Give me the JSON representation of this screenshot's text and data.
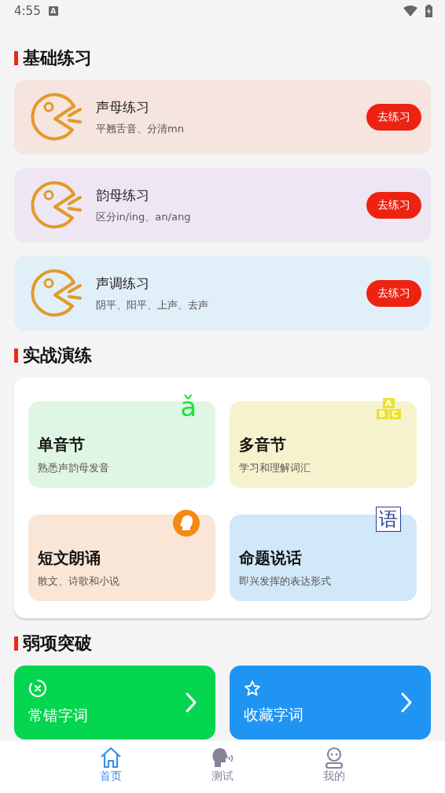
{
  "status_bar": {
    "time": "4:55",
    "notification": "A"
  },
  "sections": [
    {
      "title": "基础练习"
    },
    {
      "title": "实战演练"
    },
    {
      "title": "弱项突破"
    }
  ],
  "basic": [
    {
      "title": "声母练习",
      "subtitle": "平翘舌音、分清mn",
      "button": "去练习",
      "color": "#f6e4de"
    },
    {
      "title": "韵母练习",
      "subtitle": "区分in/ing、an/ang",
      "button": "去练习",
      "color": "#efe6f3"
    },
    {
      "title": "声调练习",
      "subtitle": "阴平、阳平、上声、去声",
      "button": "去练习",
      "color": "#e1eff8"
    }
  ],
  "practice": [
    {
      "title": "单音节",
      "subtitle": "熟悉声韵母发音",
      "color": "#e0f6e4",
      "kind": "letter",
      "badge": [
        "ǎ"
      ]
    },
    {
      "title": "多音节",
      "subtitle": "学习和理解词汇",
      "color": "#f6f2cd",
      "kind": "blocks",
      "badge": [
        "A",
        "B",
        "C"
      ]
    },
    {
      "title": "短文朗诵",
      "subtitle": "散文、诗歌和小说",
      "color": "#f9e6d6",
      "kind": "speaker"
    },
    {
      "title": "命题说话",
      "subtitle": "即兴发挥的表达形式",
      "color": "#d1e8f9",
      "kind": "boxed",
      "badge": [
        "语"
      ]
    }
  ],
  "weak": [
    {
      "title": "常错字词",
      "kind": "wrong",
      "color": "#05d64f"
    },
    {
      "title": "收藏字词",
      "kind": "star",
      "color": "#2094f2"
    }
  ],
  "tabs": [
    {
      "label": "首页",
      "kind": "home",
      "selected": true
    },
    {
      "label": "测试",
      "kind": "speak",
      "selected": false
    },
    {
      "label": "我的",
      "kind": "user",
      "selected": false
    }
  ]
}
